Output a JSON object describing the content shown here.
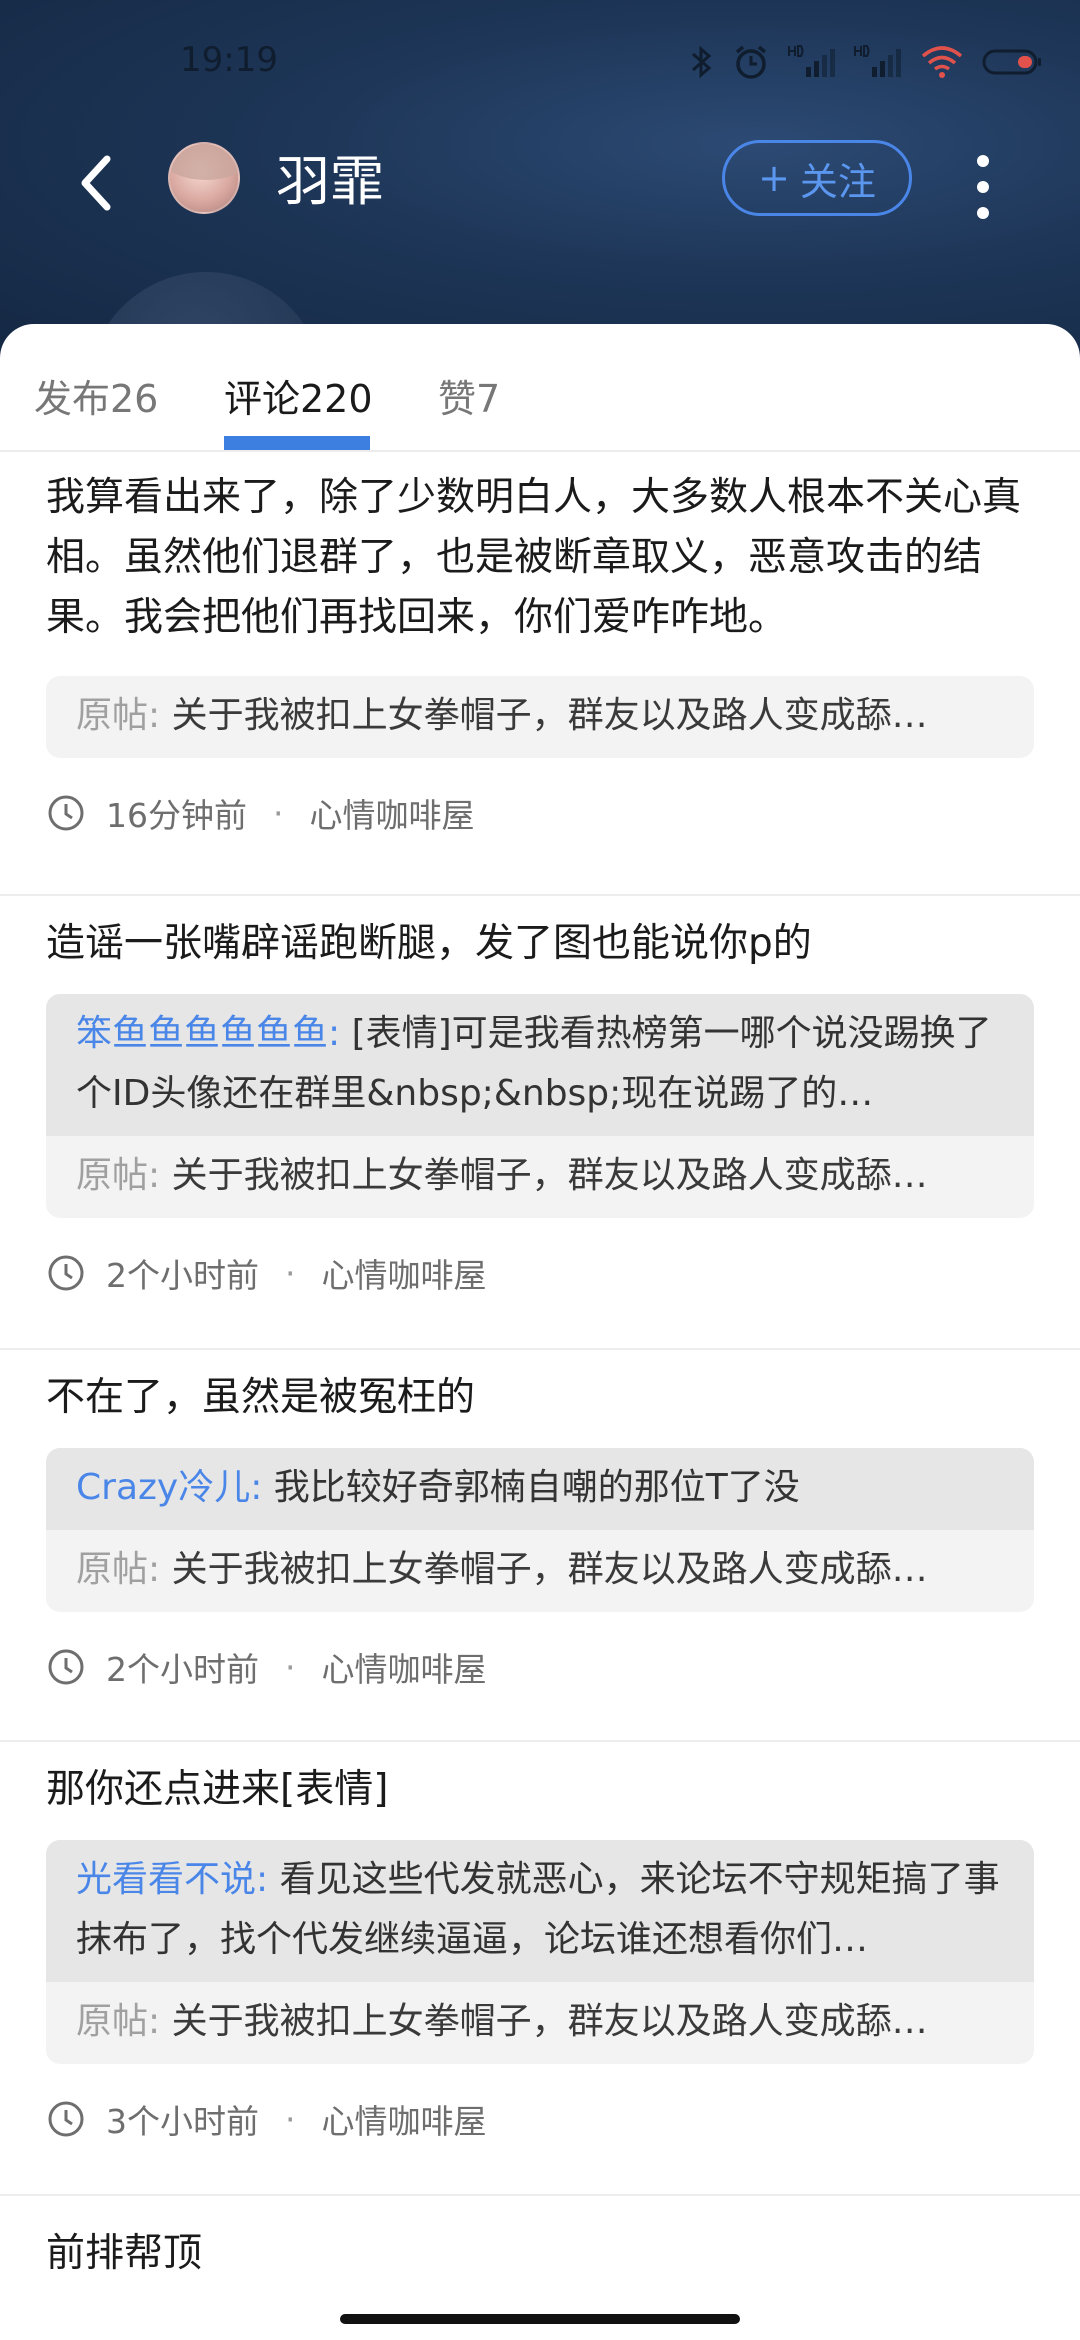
{
  "status_bar": {
    "time": "19:19"
  },
  "header": {
    "title": "羽霏",
    "follow_label": "关注",
    "follow_plus": "+"
  },
  "tabs": [
    {
      "label": "发布26",
      "active": false
    },
    {
      "label": "评论220",
      "active": true
    },
    {
      "label": "赞7",
      "active": false
    }
  ],
  "colors": {
    "accent": "#4a86e8",
    "header_bg": "#1d3556"
  },
  "items": [
    {
      "text": "我算看出来了，除了少数明白人，大多数人根本不关心真相。虽然他们退群了，也是被断章取义，恶意攻击的结果。我会把他们再找回来，你们爱咋咋地。",
      "origin_label": "原帖:",
      "origin_text": "关于我被扣上女拳帽子，群友以及路人变成舔…",
      "time": "16分钟前",
      "forum": "心情咖啡屋"
    },
    {
      "text": "造谣一张嘴辟谣跑断腿，发了图也能说你p的",
      "reply_user": "笨鱼鱼鱼鱼鱼鱼:",
      "reply_text": "[表情]可是我看热榜第一哪个说没踢换了个ID头像还在群里&nbsp;&nbsp;现在说踢了的…",
      "origin_label": "原帖:",
      "origin_text": "关于我被扣上女拳帽子，群友以及路人变成舔…",
      "time": "2个小时前",
      "forum": "心情咖啡屋"
    },
    {
      "text": "不在了，虽然是被冤枉的",
      "reply_user": "Crazy冷儿:",
      "reply_text": "我比较好奇郭楠自嘲的那位T了没",
      "origin_label": "原帖:",
      "origin_text": "关于我被扣上女拳帽子，群友以及路人变成舔…",
      "time": "2个小时前",
      "forum": "心情咖啡屋"
    },
    {
      "text": "那你还点进来[表情]",
      "reply_user": "光看看不说:",
      "reply_text": "看见这些代发就恶心，来论坛不守规矩搞了事抹布了，找个代发继续逼逼，论坛谁还想看你们…",
      "origin_label": "原帖:",
      "origin_text": "关于我被扣上女拳帽子，群友以及路人变成舔…",
      "time": "3个小时前",
      "forum": "心情咖啡屋"
    },
    {
      "text": "前排帮顶"
    }
  ],
  "separator_dot": "·"
}
